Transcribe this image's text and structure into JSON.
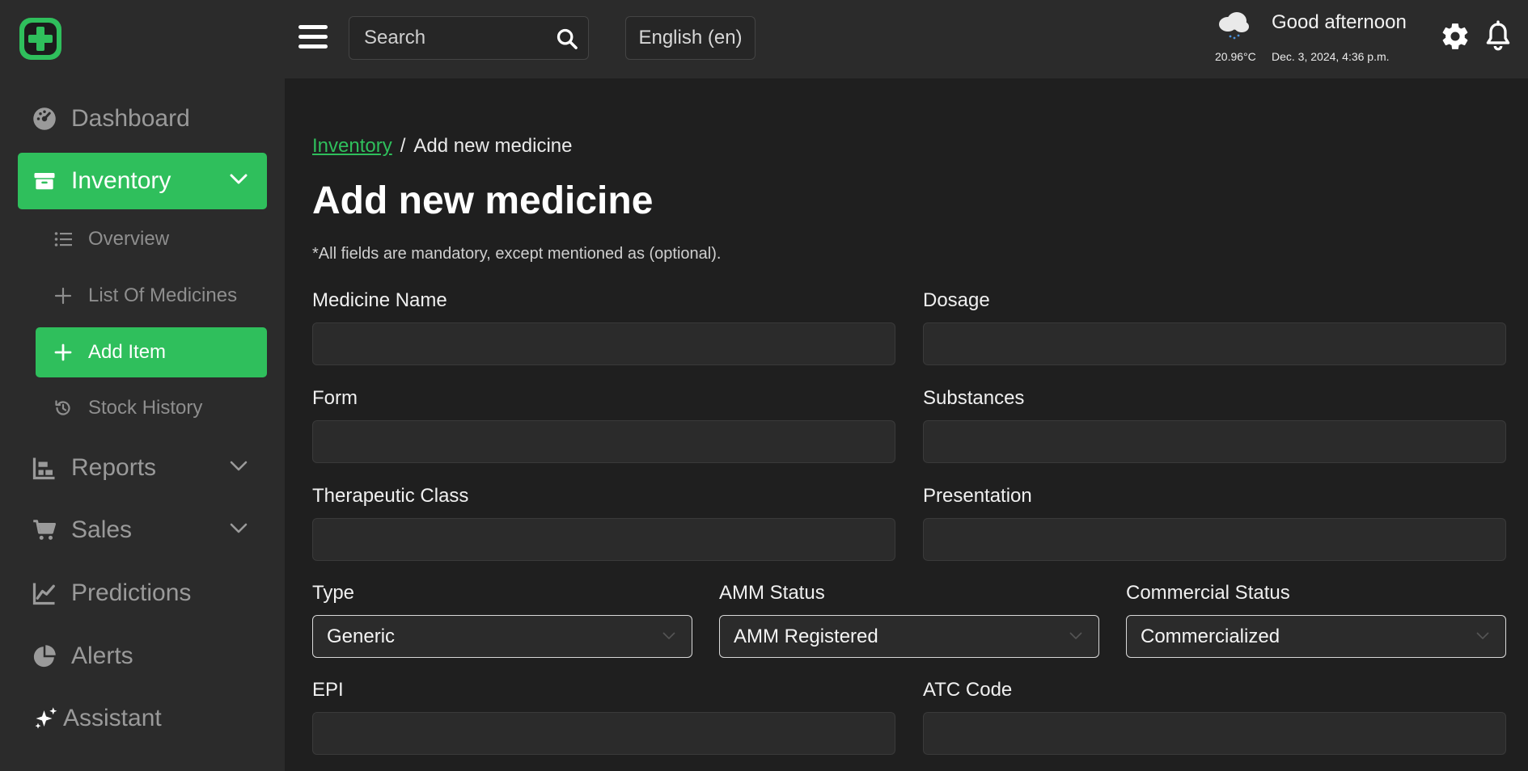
{
  "header": {
    "search_placeholder": "Search",
    "language": "English (en)",
    "temperature": "20.96°C",
    "greeting": "Good afternoon",
    "datetime": "Dec. 3, 2024, 4:36 p.m."
  },
  "sidebar": {
    "items": [
      {
        "label": "Dashboard",
        "icon": "dashboard-gauge-icon"
      },
      {
        "label": "Inventory",
        "icon": "box-icon",
        "active": true,
        "expanded": true
      },
      {
        "label": "Reports",
        "icon": "bar-chart-icon"
      },
      {
        "label": "Sales",
        "icon": "cart-icon"
      },
      {
        "label": "Predictions",
        "icon": "line-chart-icon"
      },
      {
        "label": "Alerts",
        "icon": "pie-chart-icon"
      },
      {
        "label": "Assistant",
        "icon": "sparkles-icon"
      }
    ],
    "inventory_sub": [
      {
        "label": "Overview",
        "icon": "list-icon"
      },
      {
        "label": "List Of Medicines",
        "icon": "plus-icon"
      },
      {
        "label": "Add Item",
        "icon": "plus-icon",
        "active": true
      },
      {
        "label": "Stock History",
        "icon": "history-icon"
      }
    ]
  },
  "main": {
    "breadcrumb_link": "Inventory",
    "breadcrumb_sep": "/",
    "breadcrumb_current": "Add new medicine",
    "title": "Add new medicine",
    "note": "*All fields are mandatory, except mentioned as (optional).",
    "fields": {
      "medicine_name": "Medicine Name",
      "dosage": "Dosage",
      "form": "Form",
      "substances": "Substances",
      "therapeutic_class": "Therapeutic Class",
      "presentation": "Presentation",
      "type": "Type",
      "amm_status": "AMM Status",
      "commercial_status": "Commercial Status",
      "epi": "EPI",
      "atc_code": "ATC Code"
    },
    "selects": {
      "type": "Generic",
      "amm_status": "AMM Registered",
      "commercial_status": "Commercialized"
    }
  },
  "colors": {
    "accent": "#2fbf5c",
    "sidebar_bg": "#2b2b2b",
    "main_bg": "#1f1f1f"
  }
}
